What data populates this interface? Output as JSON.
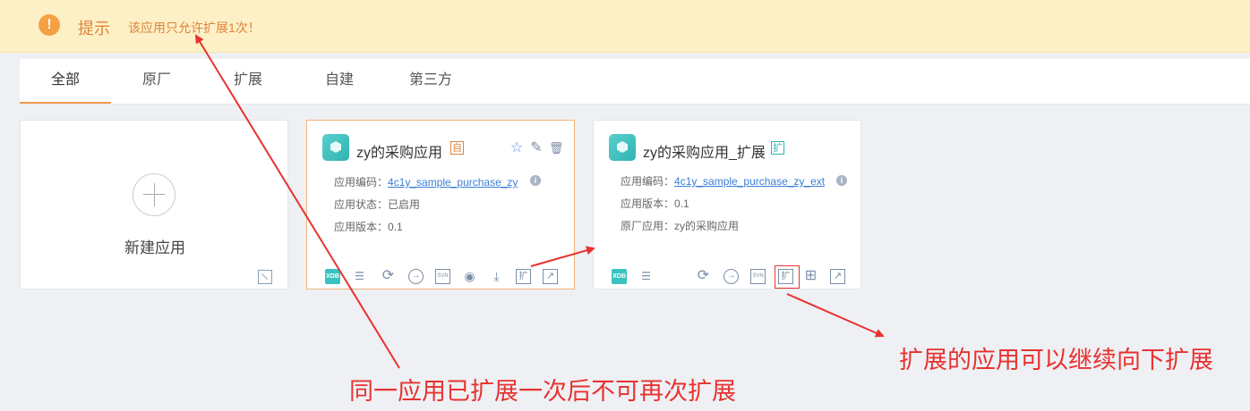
{
  "alert": {
    "icon": "exclamation-icon",
    "icon_glyph": "!",
    "title": "提示",
    "message": "该应用只允许扩展1次！"
  },
  "tabs": [
    {
      "label": "全部",
      "active": true
    },
    {
      "label": "原厂",
      "active": false
    },
    {
      "label": "扩展",
      "active": false
    },
    {
      "label": "自建",
      "active": false
    },
    {
      "label": "第三方",
      "active": false
    }
  ],
  "new_app": {
    "label": "新建应用",
    "import_icon": "import-icon"
  },
  "cards": [
    {
      "name": "zy的采购应用",
      "badge": "自",
      "top_actions": {
        "star": "☆",
        "edit": "✎",
        "delete": "🗑"
      },
      "code_label": "应用编码：",
      "code": "4c1y_sample_purchase_zy",
      "status_label": "应用状态：",
      "status": "已启用",
      "version_label": "应用版本：",
      "version": "0.1",
      "tools": {
        "xdb": "XDB",
        "list": "☰",
        "sync": "⟳",
        "enter": "→",
        "svn": "SVN",
        "view": "◉",
        "download": "⤓",
        "extend": "扩",
        "open": "↗"
      }
    },
    {
      "name": "zy的采购应用_扩展",
      "badge": "扩",
      "code_label": "应用编码：",
      "code": "4c1y_sample_purchase_zy_ext",
      "version_label": "应用版本：",
      "version": "0.1",
      "origin_label": "原厂应用：",
      "origin": "zy的采购应用",
      "tools": {
        "xdb": "XDB",
        "list": "☰",
        "sync": "⟳",
        "enter": "→",
        "svn": "SVN",
        "extend": "扩",
        "grid": "⊞",
        "open": "↗"
      }
    }
  ],
  "annotations": {
    "left": "同一应用已扩展一次后不可再次扩展",
    "right": "扩展的应用可以继续向下扩展"
  },
  "colors": {
    "accent_orange": "#f39a4a",
    "annotation_red": "#e8322f",
    "link_blue": "#3b7fd4",
    "teal": "#2fb3b0"
  }
}
